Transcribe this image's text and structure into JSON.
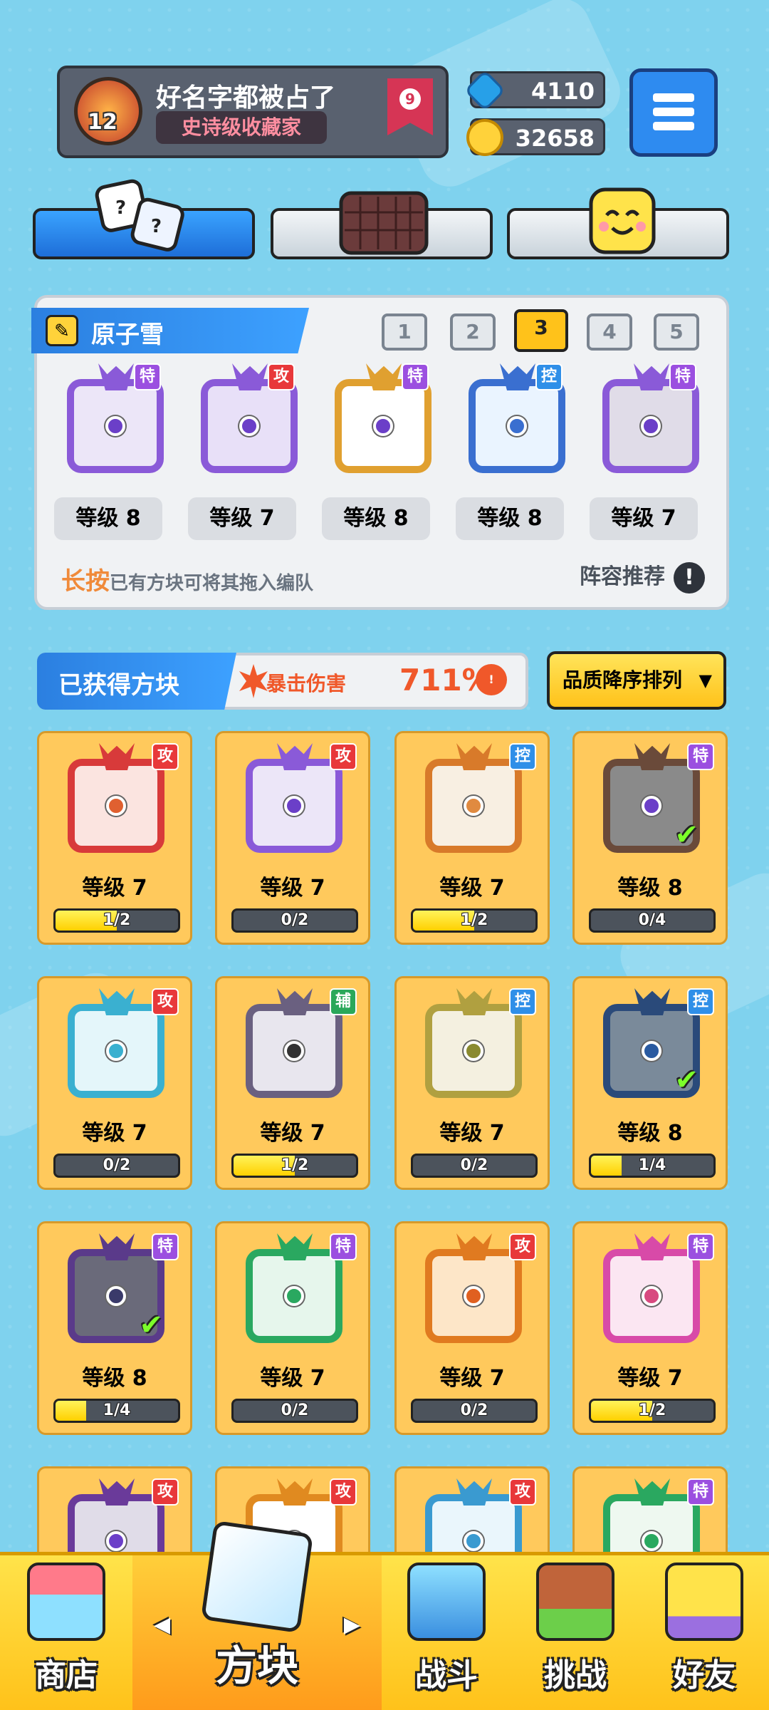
{
  "player": {
    "level": "12",
    "name": "好名字都被占了",
    "title": "史诗级收藏家",
    "rank": "9"
  },
  "currency": {
    "gems": "4110",
    "coins": "32658"
  },
  "deck": {
    "name": "原子雪",
    "slots": [
      "1",
      "2",
      "3",
      "4",
      "5"
    ],
    "selected_slot": "3",
    "dice": [
      {
        "badge": "特",
        "level": "等级 8"
      },
      {
        "badge": "攻",
        "level": "等级 7"
      },
      {
        "badge": "特",
        "level": "等级 8"
      },
      {
        "badge": "控",
        "level": "等级 8"
      },
      {
        "badge": "特",
        "level": "等级 7"
      }
    ],
    "hint_bold": "长按",
    "hint_text": "已有方块可将其拖入编队",
    "recommend": "阵容推荐",
    "recommend_icon": "!"
  },
  "owned": {
    "header": "已获得方块",
    "crit_label": "暴击伤害",
    "crit_value": "711%",
    "crit_icon": "!",
    "sort_label": "品质降序排列",
    "cards": [
      {
        "badge": "攻",
        "level": "等级 7",
        "progress": "1/2"
      },
      {
        "badge": "攻",
        "level": "等级 7",
        "progress": "0/2"
      },
      {
        "badge": "控",
        "level": "等级 7",
        "progress": "1/2"
      },
      {
        "badge": "特",
        "level": "等级 8",
        "progress": "0/4"
      },
      {
        "badge": "攻",
        "level": "等级 7",
        "progress": "0/2"
      },
      {
        "badge": "辅",
        "level": "等级 7",
        "progress": "1/2"
      },
      {
        "badge": "控",
        "level": "等级 7",
        "progress": "0/2"
      },
      {
        "badge": "控",
        "level": "等级 8",
        "progress": "1/4"
      },
      {
        "badge": "特",
        "level": "等级 8",
        "progress": "1/4"
      },
      {
        "badge": "特",
        "level": "等级 7",
        "progress": "0/2"
      },
      {
        "badge": "攻",
        "level": "等级 7",
        "progress": "0/2"
      },
      {
        "badge": "特",
        "level": "等级 7",
        "progress": "1/2"
      },
      {
        "badge": "攻"
      },
      {
        "badge": "攻"
      },
      {
        "badge": "攻"
      },
      {
        "badge": "特"
      }
    ]
  },
  "nav": [
    "商店",
    "方块",
    "战斗",
    "挑战",
    "好友"
  ],
  "badge_colors": {
    "攻": "#e8383a",
    "特": "#9b4fe0",
    "控": "#2f8fe8",
    "辅": "#2aa85a"
  }
}
